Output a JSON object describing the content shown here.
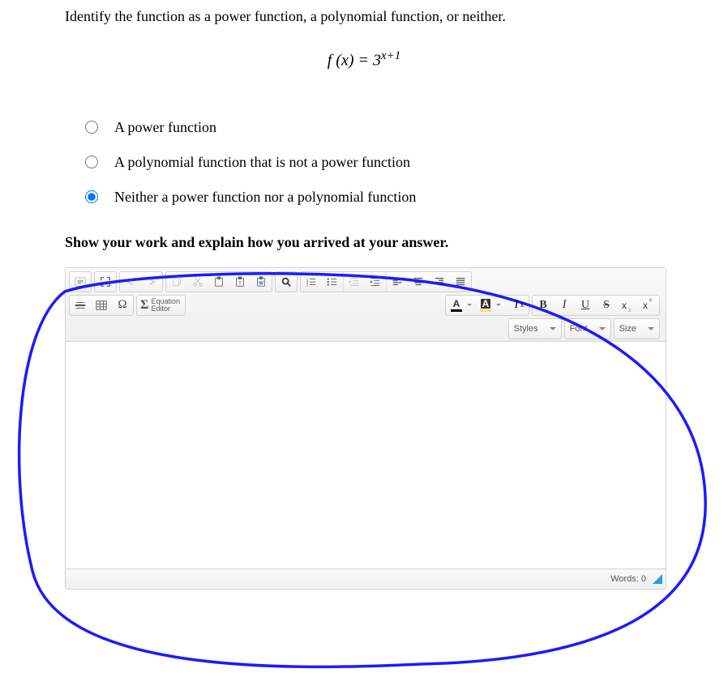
{
  "question": {
    "prompt": "Identify the function as a power function, a polynomial function, or neither.",
    "equation_base": "f (x) = 3",
    "equation_exp": "x+1"
  },
  "options": {
    "a": "A power function",
    "b": "A polynomial function that is not a power function",
    "c": "Neither a power function nor a polynomial function",
    "selected": "c"
  },
  "work": {
    "heading": "Show your work and explain how you arrived at your answer."
  },
  "editor": {
    "equation_editor_label": "Equation\nEditor",
    "styles_label": "Styles",
    "font_label": "Font",
    "size_label": "Size",
    "footer_words": "Words: 0"
  }
}
